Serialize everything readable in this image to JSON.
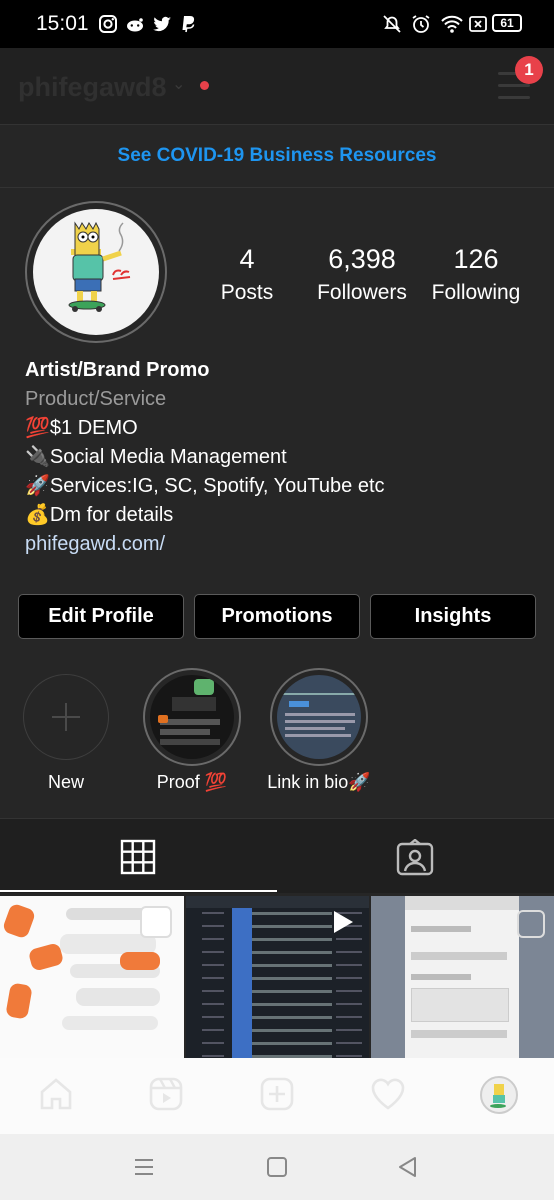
{
  "status_bar": {
    "time": "15:01",
    "battery": "61",
    "left_icons": [
      "instagram-icon",
      "reddit-icon",
      "twitter-icon",
      "paypal-icon"
    ],
    "right_icons": [
      "mute-icon",
      "alarm-icon",
      "wifi-icon",
      "screen-record-icon",
      "battery-icon"
    ]
  },
  "header": {
    "username": "phifegawd8",
    "notification_count": "1"
  },
  "banner": {
    "text": "See COVID-19 Business Resources"
  },
  "profile": {
    "stats": [
      {
        "value": "4",
        "label": "Posts"
      },
      {
        "value": "6,398",
        "label": "Followers"
      },
      {
        "value": "126",
        "label": "Following"
      }
    ],
    "name": "Artist/Brand Promo",
    "category": "Product/Service",
    "bio_lines": [
      "💯$1 DEMO",
      "🔌Social Media Management",
      "🚀Services:IG, SC, Spotify, YouTube etc",
      "💰Dm for details"
    ],
    "website": "phifegawd.com/"
  },
  "actions": {
    "edit_profile": "Edit Profile",
    "promotions": "Promotions",
    "insights": "Insights"
  },
  "highlights": [
    {
      "label": "New"
    },
    {
      "label": "Proof 💯"
    },
    {
      "label": "Link in bio🚀"
    }
  ],
  "tabs": [
    "grid-icon",
    "tagged-icon"
  ],
  "bottom_nav": [
    "home-icon",
    "reels-icon",
    "new-post-icon",
    "activity-icon",
    "profile-avatar"
  ],
  "system_nav": [
    "recents-icon",
    "home-circle-icon",
    "back-icon"
  ],
  "colors": {
    "background": "#262626",
    "accent_link": "#1e95f0",
    "badge": "#e8414a"
  }
}
